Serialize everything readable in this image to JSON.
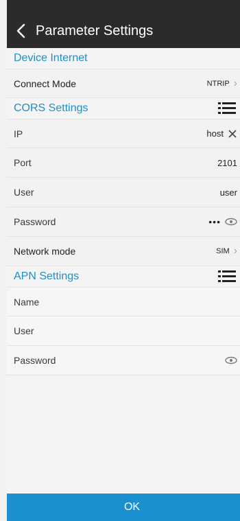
{
  "header": {
    "title": "Parameter Settings"
  },
  "sections": {
    "device_internet": {
      "title": "Device Internet",
      "connect_mode": {
        "label": "Connect Mode",
        "value": "NTRIP"
      }
    },
    "cors": {
      "title": "CORS Settings",
      "ip": {
        "label": "IP",
        "value": "host"
      },
      "port": {
        "label": "Port",
        "value": "2101"
      },
      "user": {
        "label": "User",
        "value": "user"
      },
      "password": {
        "label": "Password",
        "value": "•••"
      },
      "network_mode": {
        "label": "Network mode",
        "value": "SIM"
      }
    },
    "apn": {
      "title": "APN Settings",
      "name": {
        "label": "Name",
        "value": ""
      },
      "user": {
        "label": "User",
        "value": ""
      },
      "password": {
        "label": "Password",
        "value": ""
      }
    }
  },
  "footer": {
    "ok_label": "OK"
  },
  "colors": {
    "topbar": "#2b2b2b",
    "accent": "#1f8fc7",
    "ok_button": "#1b90d0"
  },
  "icons": [
    "chevron-left-icon",
    "list-icon",
    "chevron-right-icon",
    "clear-icon",
    "eye-icon"
  ]
}
